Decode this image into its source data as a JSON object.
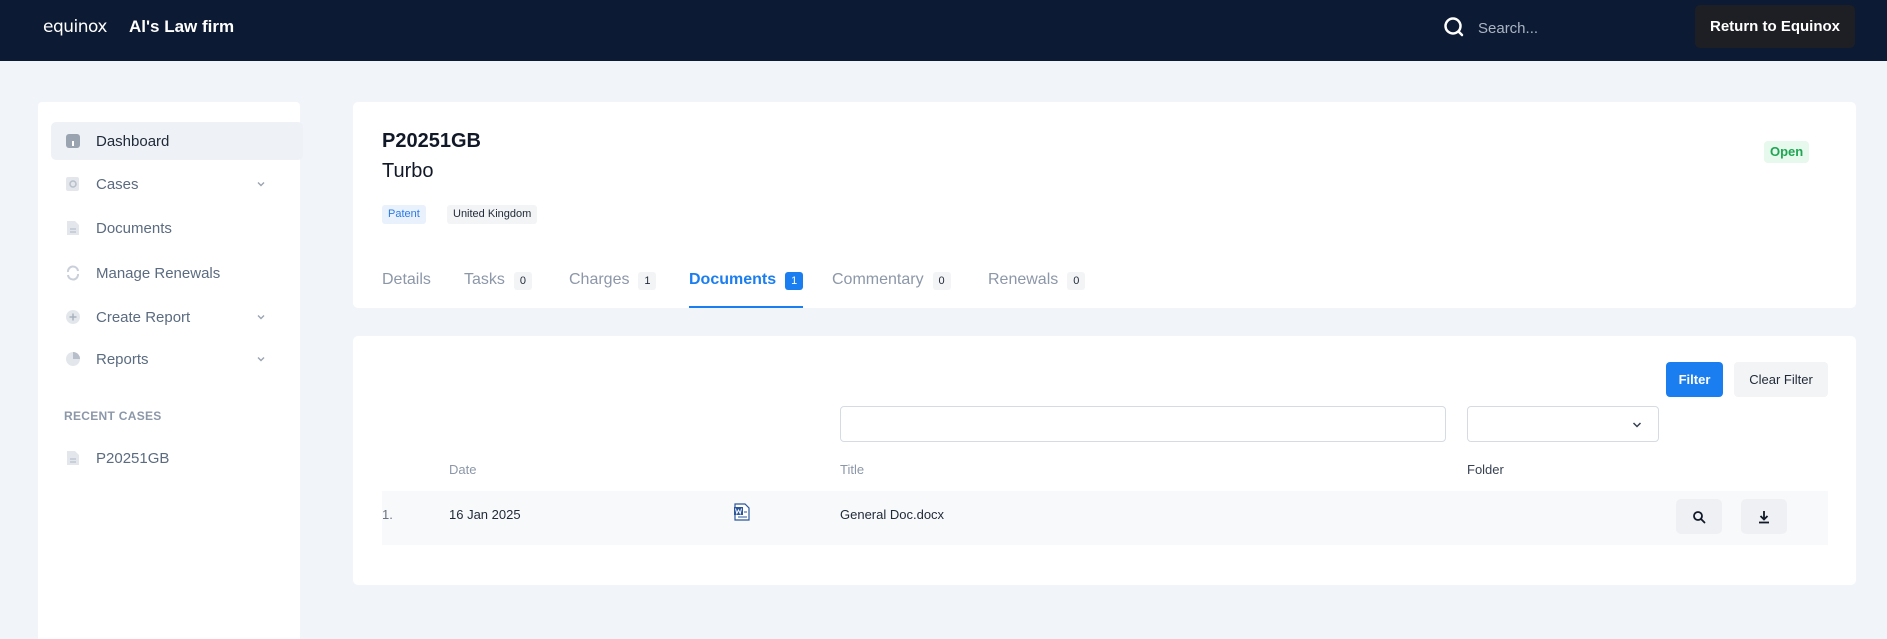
{
  "topbar": {
    "logo": "equinox",
    "firm_name": "Al's Law firm",
    "search_placeholder": "Search...",
    "return_label": "Return to Equinox"
  },
  "sidebar": {
    "items": [
      {
        "label": "Dashboard",
        "icon": "dashboard-icon",
        "active": true
      },
      {
        "label": "Cases",
        "icon": "cases-icon",
        "expandable": true
      },
      {
        "label": "Documents",
        "icon": "documents-icon"
      },
      {
        "label": "Manage Renewals",
        "icon": "renewals-icon"
      },
      {
        "label": "Create Report",
        "icon": "plus-icon",
        "expandable": true
      },
      {
        "label": "Reports",
        "icon": "pie-chart-icon",
        "expandable": true
      }
    ],
    "recent_title": "RECENT CASES",
    "recent_cases": [
      {
        "label": "P20251GB",
        "icon": "document-icon"
      }
    ]
  },
  "case": {
    "reference": "P20251GB",
    "name": "Turbo",
    "status": "Open",
    "tags": [
      "Patent",
      "United Kingdom"
    ]
  },
  "tabs": [
    {
      "label": "Details"
    },
    {
      "label": "Tasks",
      "count": "0"
    },
    {
      "label": "Charges",
      "count": "1"
    },
    {
      "label": "Documents",
      "count": "1",
      "active": true
    },
    {
      "label": "Commentary",
      "count": "0"
    },
    {
      "label": "Renewals",
      "count": "0"
    }
  ],
  "documents": {
    "filter_label": "Filter",
    "clear_filter_label": "Clear Filter",
    "title_filter_value": "",
    "folder_filter_value": "",
    "columns": {
      "date": "Date",
      "title": "Title",
      "folder": "Folder"
    },
    "rows": [
      {
        "index": "1.",
        "date": "16 Jan 2025",
        "file_icon": "word-file-icon",
        "title": "General Doc.docx",
        "folder": ""
      }
    ]
  },
  "colors": {
    "topbar": "#0c1a33",
    "accent": "#1b7ef0",
    "status_open": "#1ea653"
  }
}
